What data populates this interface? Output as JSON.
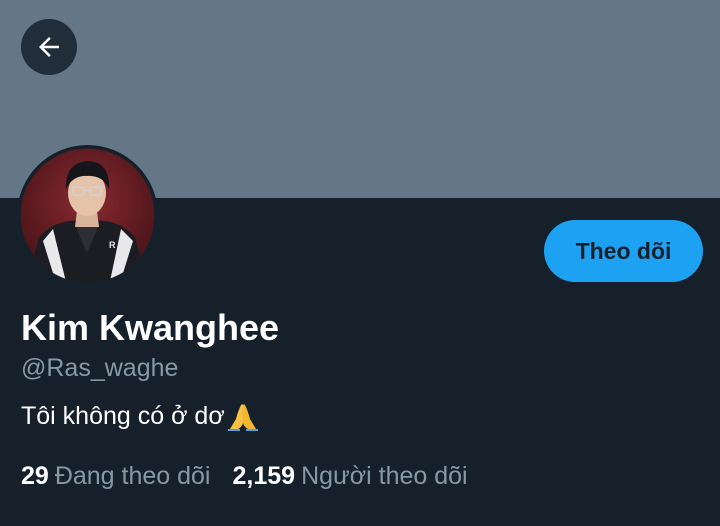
{
  "header": {
    "back_icon": "arrow-left-icon"
  },
  "profile": {
    "display_name": "Kim Kwanghee",
    "handle": "@Ras_waghe",
    "bio_text": "Tôi không có ở dơ",
    "bio_emoji": "folded-hands-emoji",
    "follow_label": "Theo dõi",
    "following_count": "29",
    "following_label": "Đang theo dõi",
    "followers_count": "2,159",
    "followers_label": "Người theo dõi"
  },
  "colors": {
    "background": "#15202b",
    "banner": "#657786",
    "accent": "#1da1f2",
    "secondary_text": "#8899a6",
    "primary_text": "#ffffff"
  }
}
